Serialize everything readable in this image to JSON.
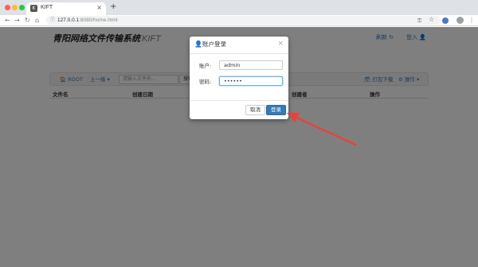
{
  "browser": {
    "tab_title": "KIFT",
    "tab_icon": "K",
    "tab_close": "×",
    "new_tab": "+",
    "url_host": "127.0.0.1",
    "url_rest": ":8080/home.html",
    "nav_back": "←",
    "nav_forward": "→",
    "nav_reload": "↻",
    "nav_home": "⌂",
    "url_info_icon": "ⓘ",
    "url_key_icon": "⚿",
    "url_star_icon": "☆",
    "menu_icon": "⋮"
  },
  "header": {
    "brand": "青阳网络文件传输系统",
    "brand_sub": "KIFT",
    "refresh": "刷新 ↻",
    "login": "登入 👤"
  },
  "toolbar": {
    "root": "🏠 ROOT",
    "up": "上一级 ▾",
    "search_placeholder": "请输入文件名...",
    "search_button": "搜索",
    "package_download": "🗃 打包下载",
    "operations": "⚙ 操作 ▾"
  },
  "table": {
    "headers": [
      "文件名",
      "创建日期",
      "创建者",
      "操作"
    ]
  },
  "login_modal": {
    "title_icon": "👤",
    "title": "账户登录",
    "close": "×",
    "account_label": "账户:",
    "account_value": "admin",
    "password_label": "密码:",
    "password_value": "••••••",
    "cancel": "取消",
    "submit": "登录"
  },
  "colors": {
    "primary": "#337ab7",
    "annotation_arrow": "#e8433a"
  }
}
